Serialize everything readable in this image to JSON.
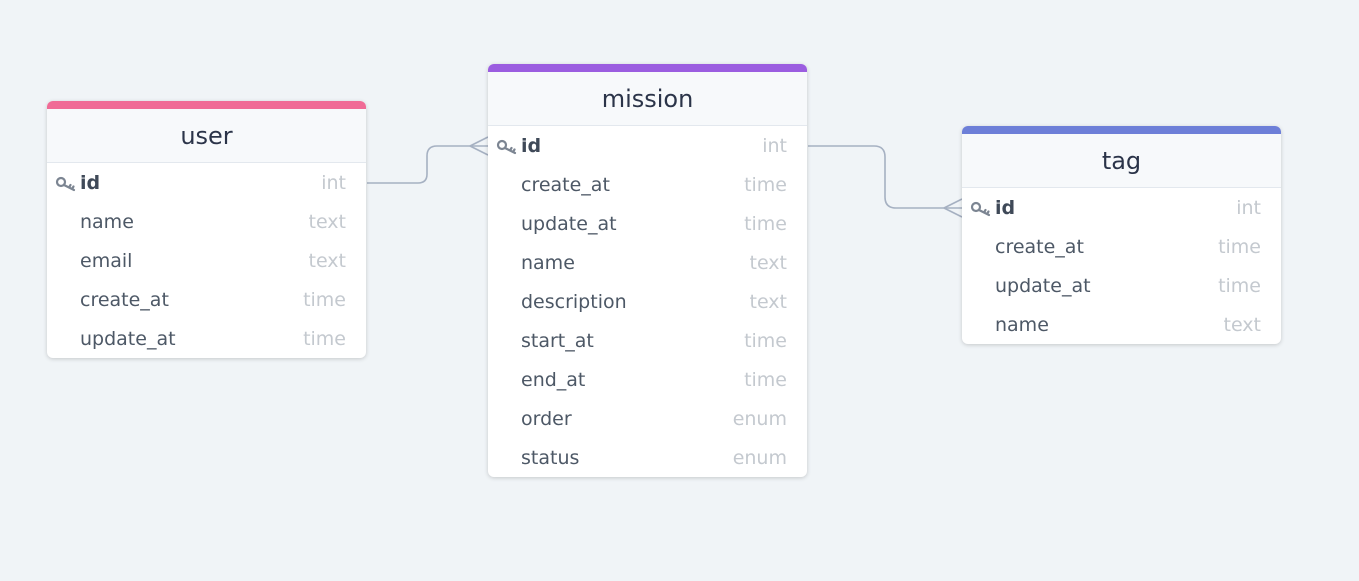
{
  "accent_colors": {
    "user": "#f06b96",
    "mission": "#9b5de0",
    "tag": "#6d7fd8",
    "edge": "#a6b1c2"
  },
  "tables": {
    "user": {
      "name": "user",
      "columns": [
        {
          "name": "id",
          "type": "int",
          "primary_key": true
        },
        {
          "name": "name",
          "type": "text"
        },
        {
          "name": "email",
          "type": "text"
        },
        {
          "name": "create_at",
          "type": "time"
        },
        {
          "name": "update_at",
          "type": "time"
        }
      ]
    },
    "mission": {
      "name": "mission",
      "columns": [
        {
          "name": "id",
          "type": "int",
          "primary_key": true
        },
        {
          "name": "create_at",
          "type": "time"
        },
        {
          "name": "update_at",
          "type": "time"
        },
        {
          "name": "name",
          "type": "text"
        },
        {
          "name": "description",
          "type": "text"
        },
        {
          "name": "start_at",
          "type": "time"
        },
        {
          "name": "end_at",
          "type": "time"
        },
        {
          "name": "order",
          "type": "enum"
        },
        {
          "name": "status",
          "type": "enum"
        }
      ]
    },
    "tag": {
      "name": "tag",
      "columns": [
        {
          "name": "id",
          "type": "int",
          "primary_key": true
        },
        {
          "name": "create_at",
          "type": "time"
        },
        {
          "name": "update_at",
          "type": "time"
        },
        {
          "name": "name",
          "type": "text"
        }
      ]
    }
  },
  "relationships": [
    {
      "from": "user.id",
      "to": "mission.id",
      "cardinality": "one-to-many"
    },
    {
      "from": "mission.id",
      "to": "tag.id",
      "cardinality": "one-to-many"
    }
  ]
}
